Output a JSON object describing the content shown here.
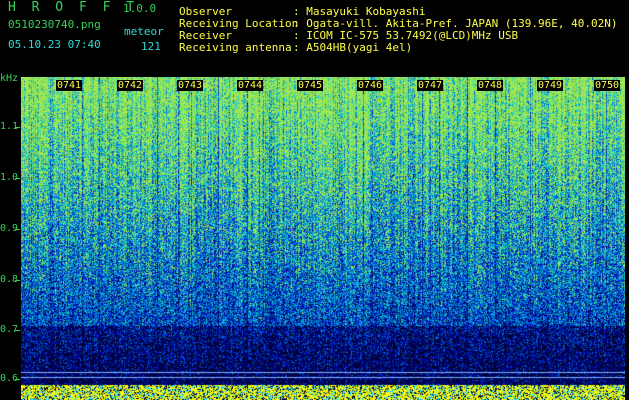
{
  "header": {
    "app_title": "H R O F F T",
    "app_version": "1.0.0",
    "file_name": "0510230740.png",
    "date_time": "05.10.23 07:40",
    "meteor_label": "meteor",
    "meteor_count": "121",
    "info": [
      {
        "label": "Observer",
        "value": ": Masayuki Kobayashi"
      },
      {
        "label": "Receiving Location",
        "value": ": Ogata-vill. Akita-Pref. JAPAN (139.96E, 40.02N)"
      },
      {
        "label": "Receiver",
        "value": ": ICOM IC-575 53.7492(@LCD)MHz USB"
      },
      {
        "label": "Receiving antenna",
        "value": ": A504HB(yagi 4el)"
      }
    ]
  },
  "spectrogram": {
    "y_unit": "kHz",
    "y_ticks": [
      "1.1",
      "1.0",
      "0.9",
      "0.8",
      "0.7",
      "0.6"
    ],
    "x_ticks": [
      "0741",
      "0742",
      "0743",
      "0744",
      "0745",
      "0746",
      "0747",
      "0748",
      "0749",
      "0750"
    ]
  },
  "colors": {
    "background": "#000000",
    "text_green": "#35d35a",
    "text_cyan": "#33d8d8",
    "tick_yellow": "#ffff4a",
    "signal_strip": "#ffff00"
  }
}
